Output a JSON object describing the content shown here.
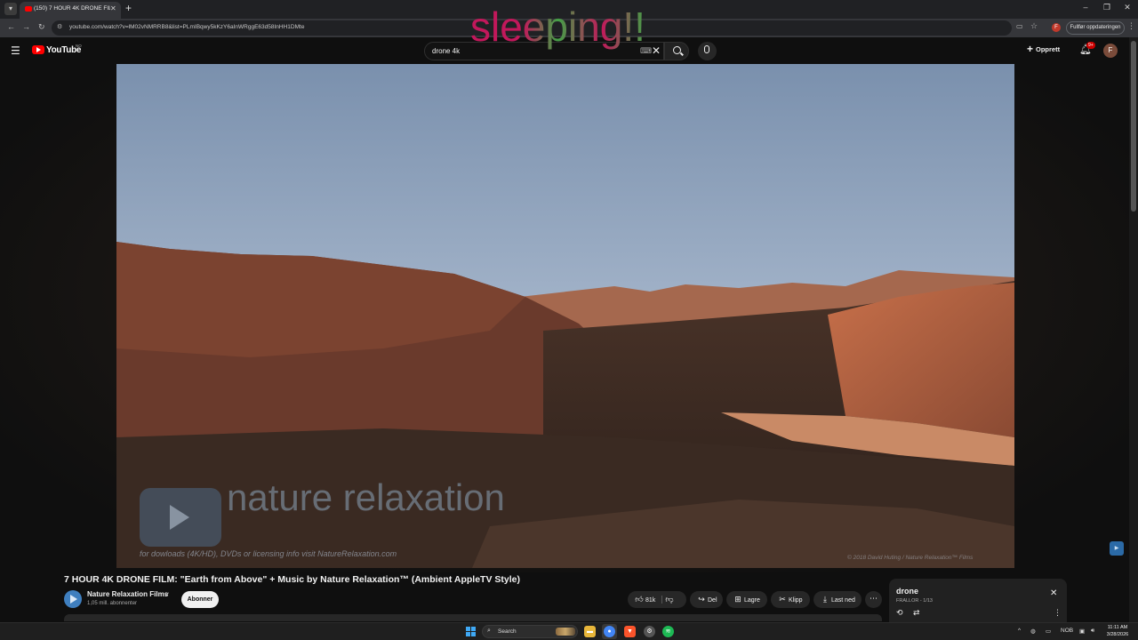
{
  "browser": {
    "tab_title": "(150) 7 HOUR 4K DRONE FILM",
    "url": "youtube.com/watch?v=lM02vNMRRB8&list=PLmIBqwy5kKzY6aInWRggE63d58InHH1DMte",
    "update_button": "Fullfør oppdateringen"
  },
  "youtube": {
    "wordmark": "YouTube",
    "region": "NO",
    "search_query": "drone 4k",
    "create_label": "Opprett",
    "notification_count": "9+",
    "avatar_initial": "F"
  },
  "overlay_text": "sleeping!!",
  "video": {
    "watermark_title": "nature relaxation",
    "watermark_subtitle": "for dowloads (4K/HD), DVDs or licensing info visit NatureRelaxation.com",
    "watermark_copyright": "© 2018 David Huting / Nature Relaxation™ Films",
    "title": "7 HOUR 4K DRONE FILM: \"Earth from Above\" + Music by Nature Relaxation™ (Ambient AppleTV Style)",
    "channel_name": "Nature Relaxation Films",
    "subscribers": "1,05 mill. abonnenter",
    "subscribe_label": "Abonner",
    "like_count": "81k",
    "share_label": "Del",
    "save_label": "Lagre",
    "clip_label": "Klipp",
    "download_label": "Last ned"
  },
  "playlist": {
    "title": "drone",
    "subtitle": "FRALLOR - 1/13"
  },
  "taskbar": {
    "search_label": "Search",
    "language": "NOB",
    "time": "11:11 AM",
    "date": "3/28/2026"
  },
  "colors": {
    "youtube_red": "#ff0000",
    "overlay_magenta": "#c2185b",
    "overlay_green": "#43a047",
    "page_bg": "#0f0f0f"
  }
}
